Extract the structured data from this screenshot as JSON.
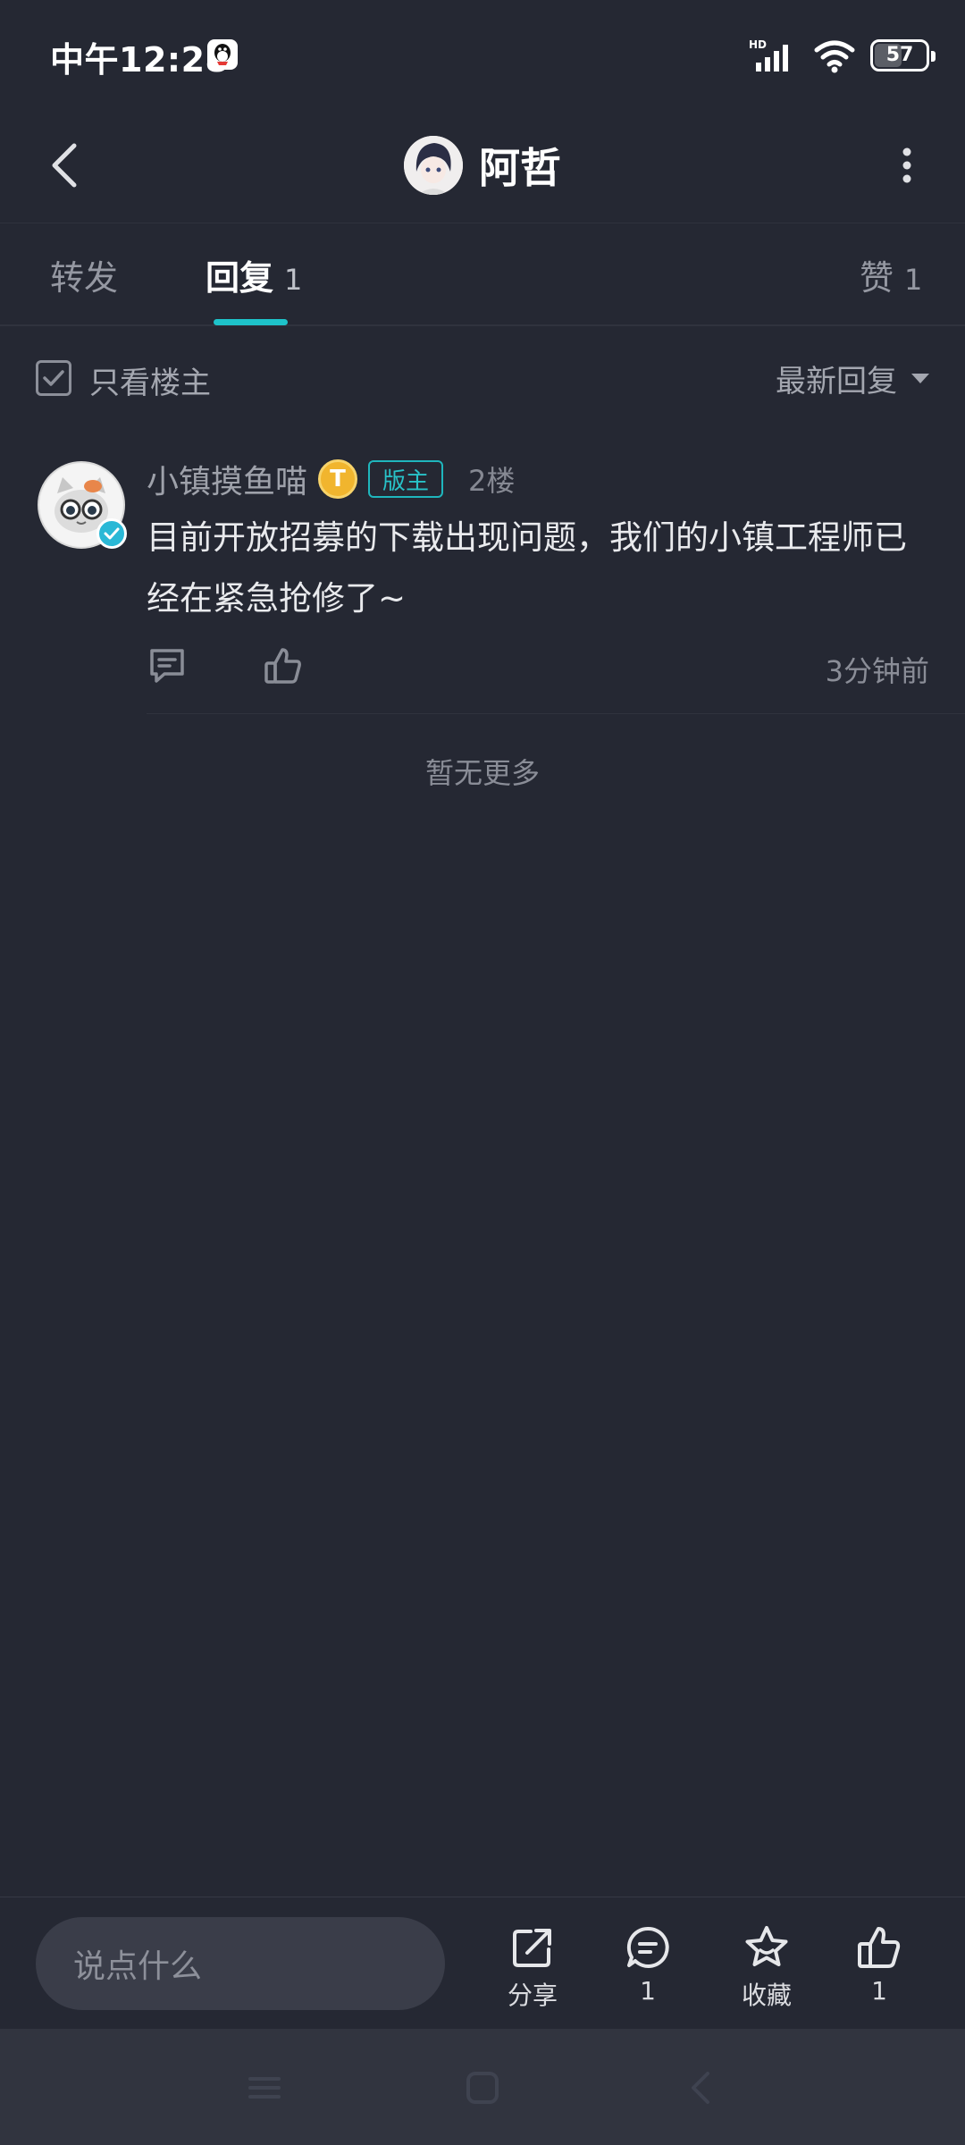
{
  "status_bar": {
    "time": "中午12:28",
    "battery": "57",
    "battery_level": 0.57,
    "icons": [
      "qq-icon",
      "hd-signal-icon",
      "wifi-icon",
      "battery-icon"
    ]
  },
  "header": {
    "title": "阿哲",
    "icons": [
      "back-arrow-icon",
      "avatar",
      "more-vertical-icon"
    ]
  },
  "tabs": [
    {
      "label": "转发",
      "count": "",
      "active": false
    },
    {
      "label": "回复",
      "count": "1",
      "active": true
    },
    {
      "label": "赞",
      "count": "1",
      "active": false
    }
  ],
  "filter": {
    "only_author_label": "只看楼主",
    "only_author_checked": true,
    "sort_label": "最新回复"
  },
  "comment": {
    "user_name": "小镇摸鱼喵",
    "level_badge": "T",
    "role_badge": "版主",
    "floor": "2楼",
    "text": "目前开放招募的下载出现问题，我们的小镇工程师已经在紧急抢修了~",
    "time": "3分钟前",
    "icons": [
      "reply-icon",
      "like-icon",
      "verified-icon"
    ]
  },
  "no_more": "暂无更多",
  "bottom_bar": {
    "input_placeholder": "说点什么",
    "share_label": "分享",
    "comment_count": "1",
    "favorite_label": "收藏",
    "like_count": "1",
    "icons": [
      "share-icon",
      "comment-icon",
      "star-icon",
      "thumb-up-icon"
    ]
  },
  "nav_bar": {
    "icons": [
      "menu-icon",
      "home-icon",
      "back-icon"
    ]
  },
  "colors": {
    "background": "#252833",
    "accent": "#1ec3ca",
    "level_badge": "#f1b52e"
  }
}
